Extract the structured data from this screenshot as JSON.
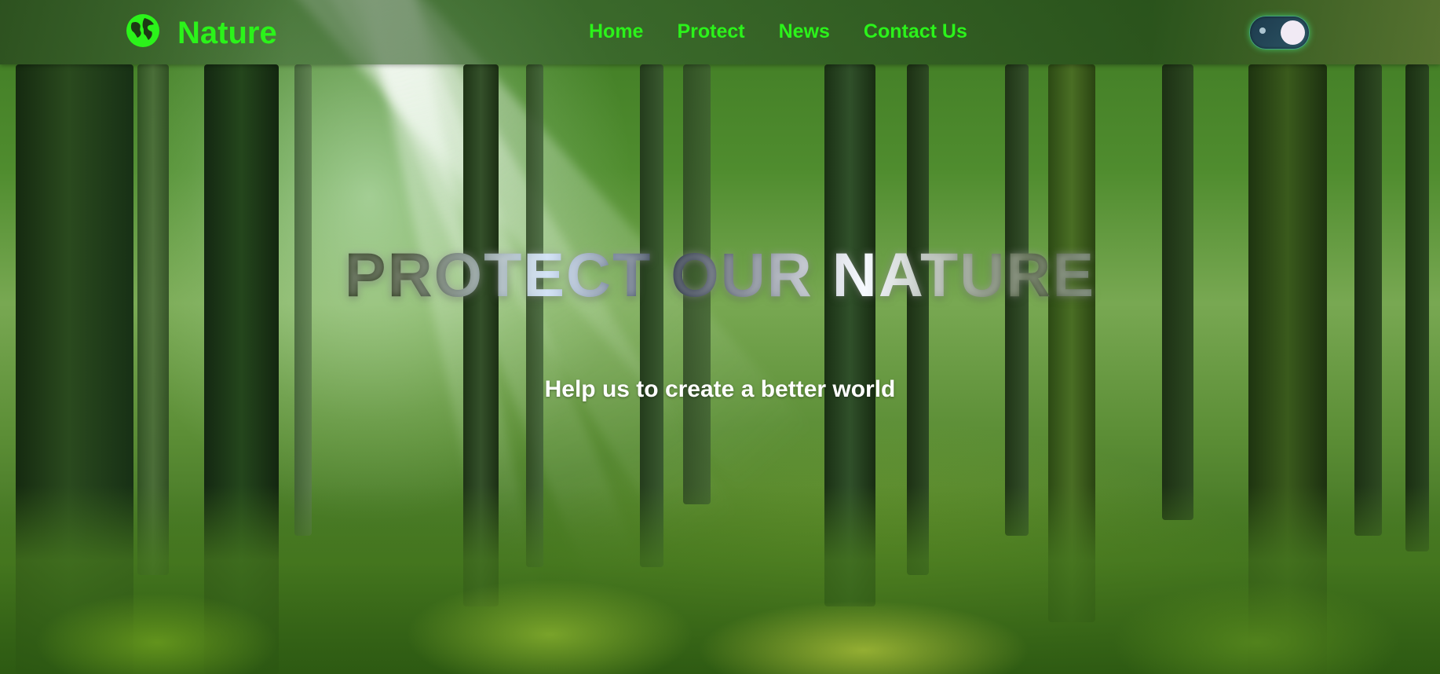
{
  "navbar": {
    "brand": {
      "icon": "globe-icon",
      "name": "Nature"
    },
    "links": [
      {
        "label": "Home"
      },
      {
        "label": "Protect"
      },
      {
        "label": "News"
      },
      {
        "label": "Contact Us"
      }
    ],
    "theme_toggle": {
      "icon": "moon-toggle-icon",
      "state": "on"
    }
  },
  "hero": {
    "title": "PROTECT OUR NATURE",
    "subtitle": "Help us to create a better world"
  },
  "colors": {
    "accent": "#2bf31a",
    "subtitle": "#ffffff"
  }
}
